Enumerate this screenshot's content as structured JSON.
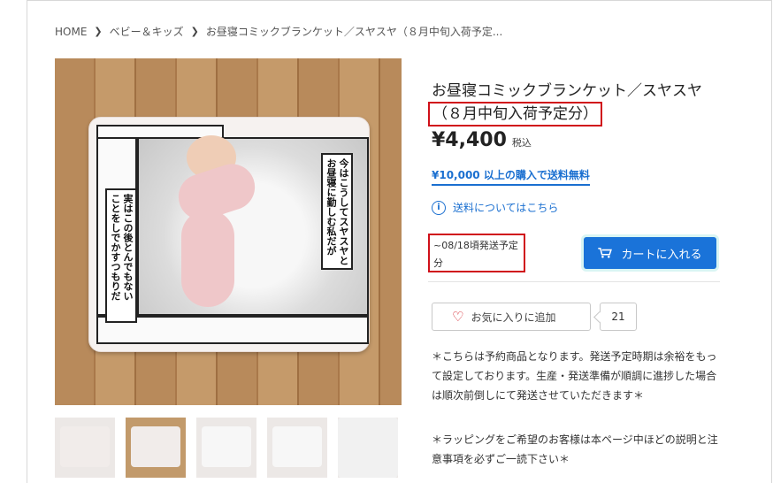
{
  "breadcrumb": [
    "HOME",
    "ベビー＆キッズ",
    "お昼寝コミックブランケット／スヤスヤ（８月中旬入荷予定..."
  ],
  "product": {
    "title_main": "お昼寝コミックブランケット／スヤスヤ",
    "title_boxed": "（８月中旬入荷予定分）",
    "price": "¥4,400",
    "tax_label": "税込",
    "free_shipping": "¥10,000 以上の購入で送料無料",
    "shipping_info": "送料についてはこちら",
    "ship_date": "~08/18頃発送予定分",
    "cart_label": "カートに入れる",
    "favorite_label": "お気に入りに追加",
    "favorite_count": "21"
  },
  "blanket_text": {
    "right_bubble": "今はこうしてスヤスヤと\nお昼寝に勤しむ私だが",
    "left_bubble": "実はこの後とんでもない\nことをしでかすつもりだ"
  },
  "notes": [
    "＊こちらは予約商品となります。発送予定時期は余裕をもって設定しております。生産・発送準備が順調に進捗した場合は順次前倒しにて発送させていただきます＊",
    "＊ラッピングをご希望のお客様は本ページ中ほどの説明と注意事項を必ずご一読下さい＊"
  ],
  "colors": {
    "accent_blue": "#1a73d9",
    "link_blue": "#1a6fd0",
    "highlight_red": "#d0101a"
  },
  "icons": {
    "breadcrumb_separator": "chevron-right-icon",
    "info": "info-icon",
    "cart": "cart-icon",
    "favorite": "heart-icon"
  }
}
